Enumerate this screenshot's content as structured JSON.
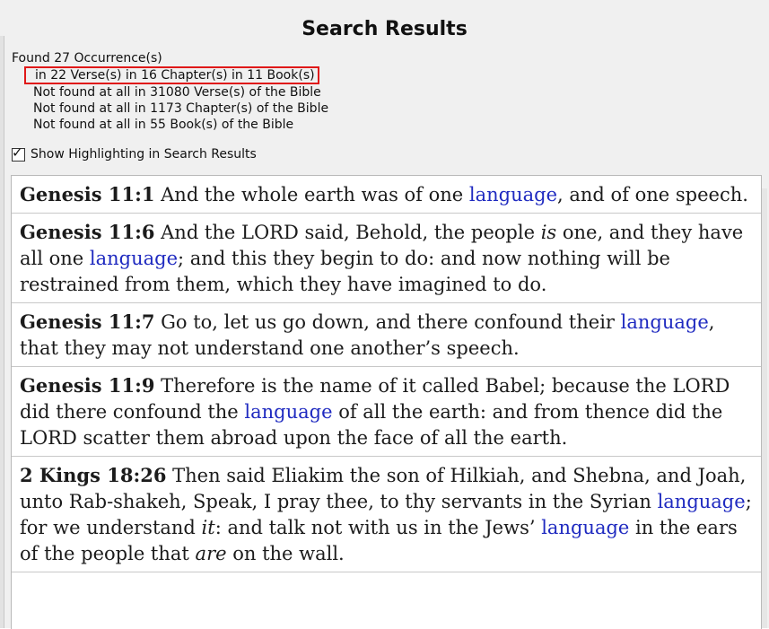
{
  "title": "Search Results",
  "stats": {
    "found": "Found 27 Occurrence(s)",
    "in_verses": "in 22 Verse(s) in 16 Chapter(s) in 11 Book(s)",
    "nf_verses": "Not found at all in 31080 Verse(s) of the Bible",
    "nf_chapters": "Not found at all in 1173 Chapter(s) of the Bible",
    "nf_books": "Not found at all in 55 Book(s) of the Bible"
  },
  "highlight_checkbox": {
    "label": "Show Highlighting in Search Results",
    "checked": true
  },
  "highlight_color": "#1f2ac0",
  "results": [
    {
      "ref": "Genesis 11:1",
      "parts": [
        {
          "t": " And the whole earth was of one "
        },
        {
          "t": "language",
          "hl": true
        },
        {
          "t": ", and of one speech."
        }
      ]
    },
    {
      "ref": "Genesis 11:6",
      "parts": [
        {
          "t": " And the LORD said, Behold, the people "
        },
        {
          "t": "is",
          "it": true
        },
        {
          "t": " one, and they have all one "
        },
        {
          "t": "language",
          "hl": true
        },
        {
          "t": "; and this they begin to do: and now nothing will be restrained from them, which they have imagined to do."
        }
      ]
    },
    {
      "ref": "Genesis 11:7",
      "parts": [
        {
          "t": " Go to, let us go down, and there confound their "
        },
        {
          "t": "language",
          "hl": true
        },
        {
          "t": ", that they may not understand one another’s speech."
        }
      ]
    },
    {
      "ref": "Genesis 11:9",
      "parts": [
        {
          "t": " Therefore is the name of it called Babel; because the LORD did there confound the "
        },
        {
          "t": "language",
          "hl": true
        },
        {
          "t": " of all the earth: and from thence did the LORD scatter them abroad upon the face of all the earth."
        }
      ]
    },
    {
      "ref": "2 Kings 18:26",
      "parts": [
        {
          "t": " Then said Eliakim the son of Hilkiah, and Shebna, and Joah, unto Rab-shakeh, Speak, I pray thee, to thy servants in the Syrian "
        },
        {
          "t": "language",
          "hl": true
        },
        {
          "t": "; for we understand "
        },
        {
          "t": "it",
          "it": true
        },
        {
          "t": ": and talk not with us in the Jews’ "
        },
        {
          "t": "language",
          "hl": true
        },
        {
          "t": " in the ears of the people that "
        },
        {
          "t": "are",
          "it": true
        },
        {
          "t": " on the wall."
        }
      ]
    }
  ]
}
